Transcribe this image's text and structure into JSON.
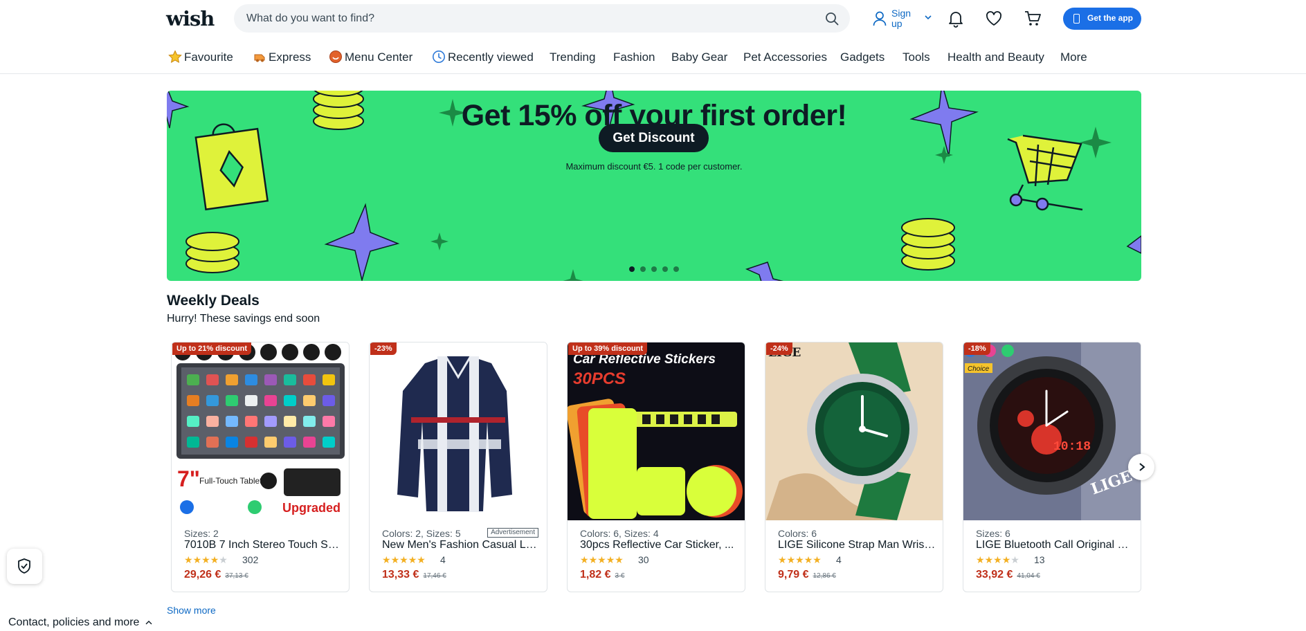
{
  "brand": {
    "logo_text": "wish",
    "accent": "#1b6fe6",
    "banner_color": "#34e07a",
    "sale_color": "#c0301a"
  },
  "header": {
    "search_placeholder": "What do you want to find?",
    "signup_label": "Sign up",
    "get_app_label": "Get the app",
    "icons": [
      "search-icon",
      "user-icon",
      "bell-icon",
      "heart-icon",
      "cart-icon",
      "phone-icon"
    ]
  },
  "nav": {
    "items": [
      {
        "label": "Favourite",
        "icon": "star-icon"
      },
      {
        "label": "Express",
        "icon": "express-icon"
      },
      {
        "label": "Menu Center",
        "icon": "menu-center-icon"
      },
      {
        "label": "Recently viewed",
        "icon": "clock-icon"
      },
      {
        "label": "Trending"
      },
      {
        "label": "Fashion"
      },
      {
        "label": "Baby Gear"
      },
      {
        "label": "Pet Accessories"
      },
      {
        "label": "Gadgets"
      },
      {
        "label": "Tools"
      },
      {
        "label": "Health and Beauty"
      },
      {
        "label": "More"
      }
    ]
  },
  "banner": {
    "title": "Get 15% off your first order!",
    "button": "Get Discount",
    "note": "Maximum discount €5. 1 code per customer.",
    "slides": 5,
    "active_slide": 1
  },
  "deals": {
    "title": "Weekly Deals",
    "subtitle": "Hurry! These savings end soon",
    "show_more": "Show more",
    "products": [
      {
        "badge": "Up to 21% discount",
        "variants": "Sizes: 2",
        "name": "7010B 7 Inch Stereo Touch Scr...",
        "rating": 4,
        "reviews": "302",
        "price": "29,26 €",
        "old_price": "37,13 €",
        "ad": ""
      },
      {
        "badge": "-23%",
        "variants": "Colors: 2, Sizes: 5",
        "name": "New Men's Fashion Casual Lo...",
        "rating": 5,
        "reviews": "4",
        "price": "13,33 €",
        "old_price": "17,46 €",
        "ad": "Advertisement"
      },
      {
        "badge": "Up to 39% discount",
        "variants": "Colors: 6, Sizes: 4",
        "name": "30pcs Reflective Car Sticker, ...",
        "rating": 5,
        "reviews": "30",
        "price": "1,82 €",
        "old_price": "3 €",
        "ad": ""
      },
      {
        "badge": "-24%",
        "variants": "Colors: 6",
        "name": "LIGE Silicone Strap Man Wrist...",
        "rating": 5,
        "reviews": "4",
        "price": "9,79 €",
        "old_price": "12,86 €",
        "ad": ""
      },
      {
        "badge": "-18%",
        "variants": "Sizes: 6",
        "name": "LIGE Bluetooth Call Original S...",
        "rating": 4,
        "reviews": "13",
        "price": "33,92 €",
        "old_price": "41,04 €",
        "ad": ""
      }
    ],
    "image_text": {
      "tablet_size": "7\"",
      "tablet_caption": "Full-Touch Tablet",
      "tablet_tag": "Upgraded",
      "sticker_title": "Car Reflective Stickers",
      "sticker_count": "30PCS",
      "watch_brand": "LIGE",
      "watch_time": "10:18",
      "watch_choice": "Choice"
    }
  },
  "footer": {
    "contact_label": "Contact, policies and more"
  }
}
